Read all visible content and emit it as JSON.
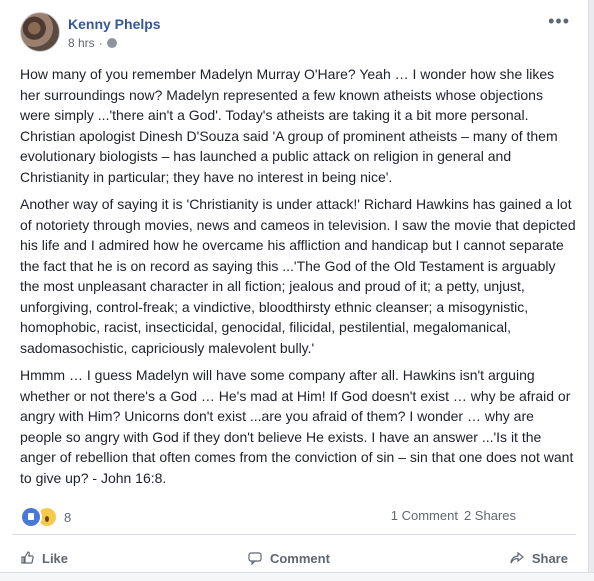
{
  "post": {
    "author": "Kenny Phelps",
    "time": "8 hrs",
    "visibility_icon": "globe-icon",
    "more_label": "•••",
    "paragraphs": [
      "How many of you remember Madelyn Murray O'Hare? Yeah … I wonder how she likes her surroundings now? Madelyn represented a few known atheists whose objections were simply ...'there ain't a God'. Today's atheists are taking it a bit more personal. Christian apologist Dinesh D'Souza said 'A group of prominent atheists – many of them evolutionary biologists – has launched a public attack on religion in general and Christianity in particular; they have no interest in being nice'.",
      "Another way of saying it is 'Christianity is under attack!' Richard Hawkins has gained a lot of notoriety through movies, news and cameos in television. I saw the movie that depicted his life and I admired how he overcame his affliction and handicap but I cannot separate the fact that he is on record as saying this ...'The God of the Old Testament is arguably the most unpleasant character in all fiction; jealous and proud of it; a petty, unjust, unforgiving, control-freak; a vindictive, bloodthirsty ethnic cleanser; a misogynistic, homophobic, racist, insecticidal, genocidal, filicidal, pestilential, megalomanical, sadomasochistic, capriciously malevolent bully.'",
      "Hmmm … I guess Madelyn will have some company after all. Hawkins isn't arguing whether or not there's a God … He's mad at Him! If God doesn't exist … why be afraid or angry with Him? Unicorns don't exist ...are you afraid of them? I wonder … why are people so angry with God if they don't believe He exists. I have an answer ...'Is it the anger of rebellion that often comes from the conviction of sin – sin that one does not want to give up? - John 16:8."
    ]
  },
  "stats": {
    "reaction_icons": [
      "like-reaction-icon",
      "wow-reaction-icon"
    ],
    "reaction_count": "8",
    "comments": "1 Comment",
    "shares": "2 Shares"
  },
  "actions": {
    "like": "Like",
    "comment": "Comment",
    "share": "Share"
  },
  "colors": {
    "author_link": "#365899",
    "like_blue": "#4a78d6",
    "wow_yellow": "#f7c94b"
  }
}
